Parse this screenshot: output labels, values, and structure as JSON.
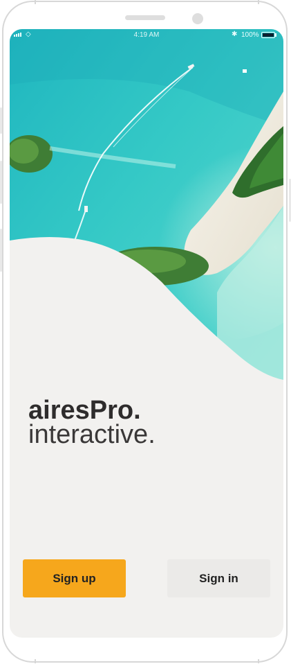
{
  "status_bar": {
    "time": "4:19 AM",
    "battery": "100%",
    "wifi_icon": "wifi-icon",
    "bluetooth_icon": "bluetooth-icon"
  },
  "hero": {
    "image": "aerial-tropical-islands-photo",
    "colors": {
      "sea": "#2cc6c7",
      "deep_sea": "#1aa8b4",
      "sand": "#f0ede4",
      "forest": "#2f6e2c"
    }
  },
  "brand": {
    "name": "airesPro.",
    "tagline": "interactive."
  },
  "actions": {
    "sign_up": "Sign up",
    "sign_in": "Sign in"
  },
  "colors": {
    "accent": "#f6a71c",
    "background": "#f2f1ef",
    "secondary_button": "#ebeae8"
  }
}
